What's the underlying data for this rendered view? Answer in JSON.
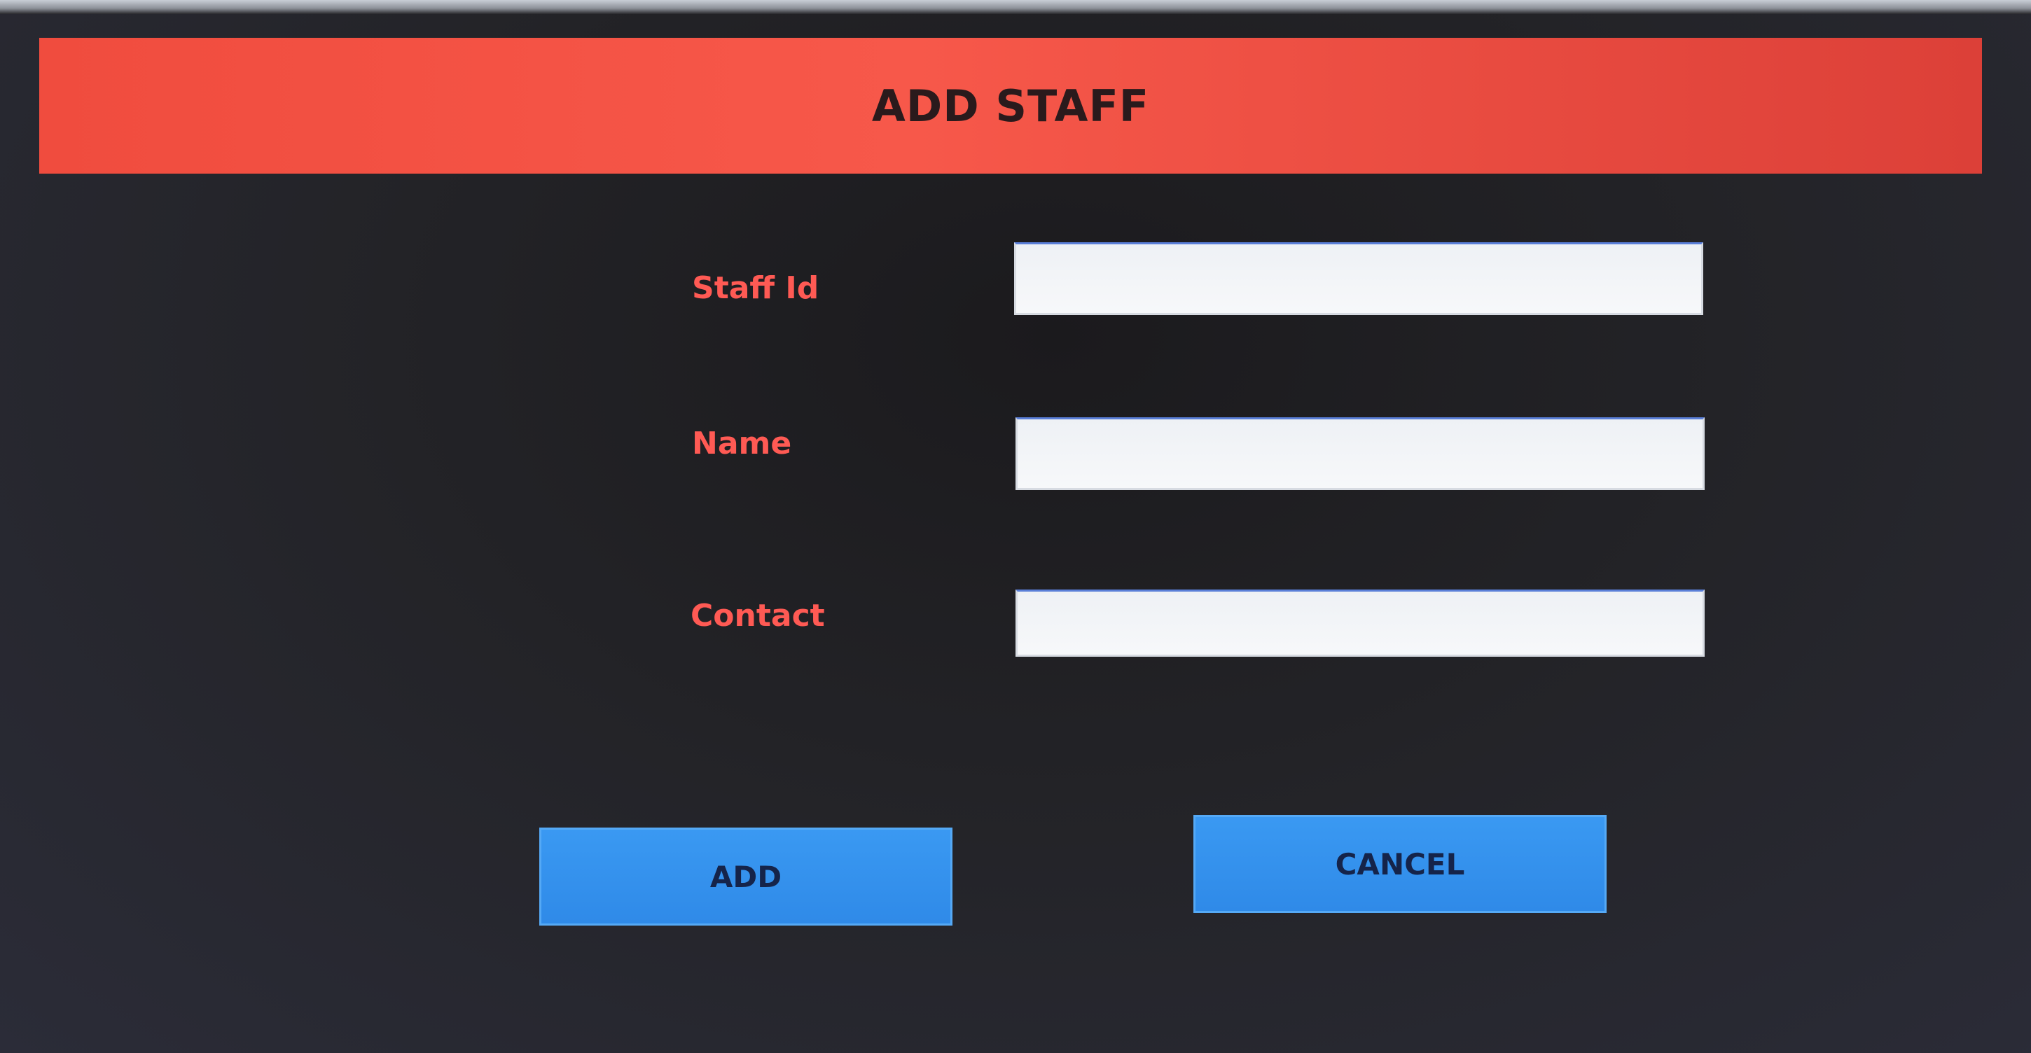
{
  "dialog": {
    "title": "ADD STAFF"
  },
  "form": {
    "fields": [
      {
        "label": "Staff Id",
        "value": "",
        "placeholder": ""
      },
      {
        "label": "Name",
        "value": "",
        "placeholder": ""
      },
      {
        "label": "Contact",
        "value": "",
        "placeholder": ""
      }
    ]
  },
  "actions": {
    "add_label": "ADD",
    "cancel_label": "CANCEL"
  },
  "colors": {
    "header_bg": "#f7584a",
    "label_text": "#ff5a54",
    "button_bg": "#3a99f2",
    "background": "#232327"
  }
}
